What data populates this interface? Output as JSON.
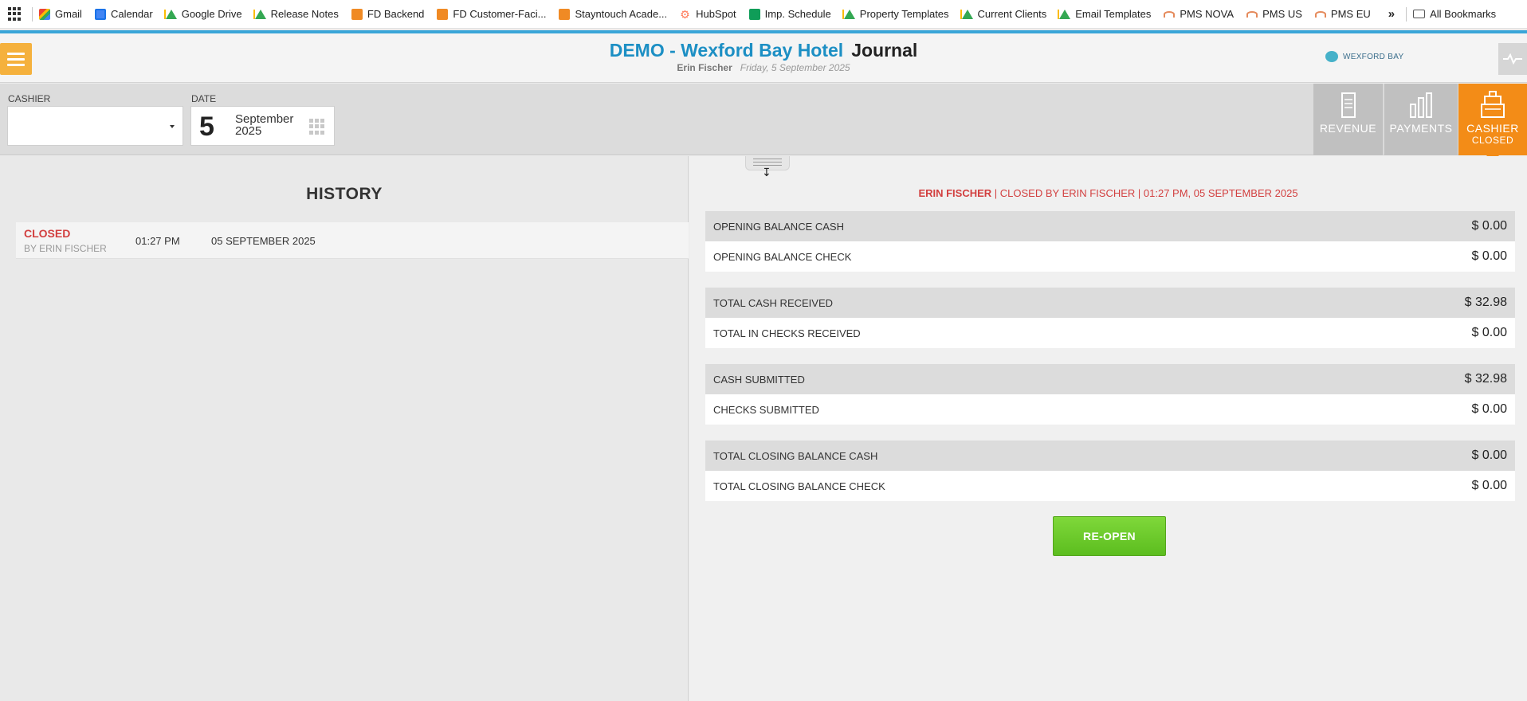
{
  "bookmarks": {
    "items": [
      {
        "label": "Gmail",
        "icon": "gmail-icon"
      },
      {
        "label": "Calendar",
        "icon": "calendar-icon"
      },
      {
        "label": "Google Drive",
        "icon": "drive-icon"
      },
      {
        "label": "Release Notes",
        "icon": "drive-icon"
      },
      {
        "label": "FD Backend",
        "icon": "stayntouch-icon"
      },
      {
        "label": "FD Customer-Faci...",
        "icon": "stayntouch-icon"
      },
      {
        "label": "Stayntouch Acade...",
        "icon": "stayntouch-icon"
      },
      {
        "label": "HubSpot",
        "icon": "hubspot-icon"
      },
      {
        "label": "Imp. Schedule",
        "icon": "sheets-icon"
      },
      {
        "label": "Property Templates",
        "icon": "drive-icon"
      },
      {
        "label": "Current Clients",
        "icon": "drive-icon"
      },
      {
        "label": "Email Templates",
        "icon": "drive-icon"
      },
      {
        "label": "PMS NOVA",
        "icon": "pms-icon"
      },
      {
        "label": "PMS US",
        "icon": "pms-icon"
      },
      {
        "label": "PMS EU",
        "icon": "pms-icon"
      }
    ],
    "more": "»",
    "all_bookmarks": "All Bookmarks"
  },
  "header": {
    "hotel": "DEMO - Wexford Bay Hotel",
    "page": "Journal",
    "user": "Erin Fischer",
    "date": "Friday, 5 September 2025",
    "brand": "WEXFORD BAY"
  },
  "toolbar": {
    "cashier_label": "CASHIER",
    "cashier_value": "",
    "date_label": "DATE",
    "date_day": "5",
    "date_month": "September",
    "date_year": "2025",
    "tiles": {
      "revenue": "REVENUE",
      "payments": "PAYMENTS",
      "cashier": "CASHIER",
      "cashier_sub": "CLOSED"
    }
  },
  "history": {
    "title": "HISTORY",
    "rows": [
      {
        "status": "CLOSED",
        "by": "BY ERIN FISCHER",
        "time": "01:27 PM",
        "date": "05 SEPTEMBER 2025"
      }
    ]
  },
  "details": {
    "closed_name": "ERIN FISCHER",
    "closed_rest": " | CLOSED BY ERIN FISCHER | 01:27 PM, 05 SEPTEMBER 2025",
    "rows": [
      {
        "label": "OPENING BALANCE CASH",
        "amount": "$ 0.00"
      },
      {
        "label": "OPENING BALANCE CHECK",
        "amount": "$ 0.00"
      },
      {
        "label": "TOTAL CASH RECEIVED",
        "amount": "$ 32.98"
      },
      {
        "label": "TOTAL IN CHECKS RECEIVED",
        "amount": "$ 0.00"
      },
      {
        "label": "CASH SUBMITTED",
        "amount": "$ 32.98"
      },
      {
        "label": "CHECKS SUBMITTED",
        "amount": "$ 0.00"
      },
      {
        "label": "TOTAL CLOSING BALANCE CASH",
        "amount": "$ 0.00"
      },
      {
        "label": "TOTAL CLOSING BALANCE CHECK",
        "amount": "$ 0.00"
      }
    ],
    "reopen_label": "RE-OPEN"
  },
  "colors": {
    "accent_blue": "#1c8fc4",
    "menu_orange": "#f5b13d",
    "cashier_orange": "#f38c17",
    "closed_red": "#d23f3f",
    "reopen_green": "#5cbd1f"
  }
}
